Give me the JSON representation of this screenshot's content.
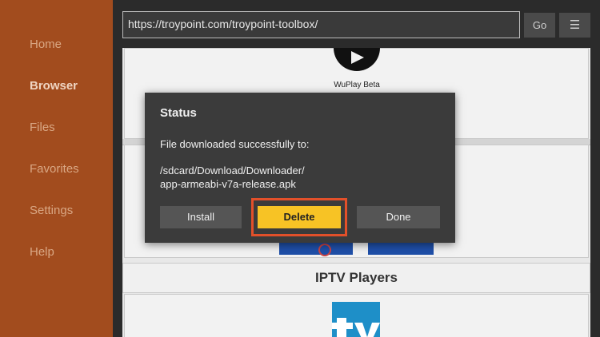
{
  "sidebar": {
    "items": [
      {
        "label": "Home"
      },
      {
        "label": "Browser"
      },
      {
        "label": "Files"
      },
      {
        "label": "Favorites"
      },
      {
        "label": "Settings"
      },
      {
        "label": "Help"
      }
    ],
    "active": "Browser"
  },
  "toolbar": {
    "url": "https://troypoint.com/troypoint-toolbox/",
    "go_label": "Go",
    "menu_label": "☰"
  },
  "webpage": {
    "app_label": "WuPlay Beta",
    "section_header": "IPTV Players"
  },
  "dialog": {
    "title": "Status",
    "message": "File downloaded successfully to:",
    "path_line1": "/sdcard/Download/Downloader/",
    "path_line2": "app-armeabi-v7a-release.apk",
    "install_label": "Install",
    "delete_label": "Delete",
    "done_label": "Done"
  },
  "colors": {
    "sidebar_bg": "#a24c1e",
    "delete_button": "#f7c325",
    "highlight_border": "#e2502a",
    "dialog_bg": "#3b3b3b"
  }
}
